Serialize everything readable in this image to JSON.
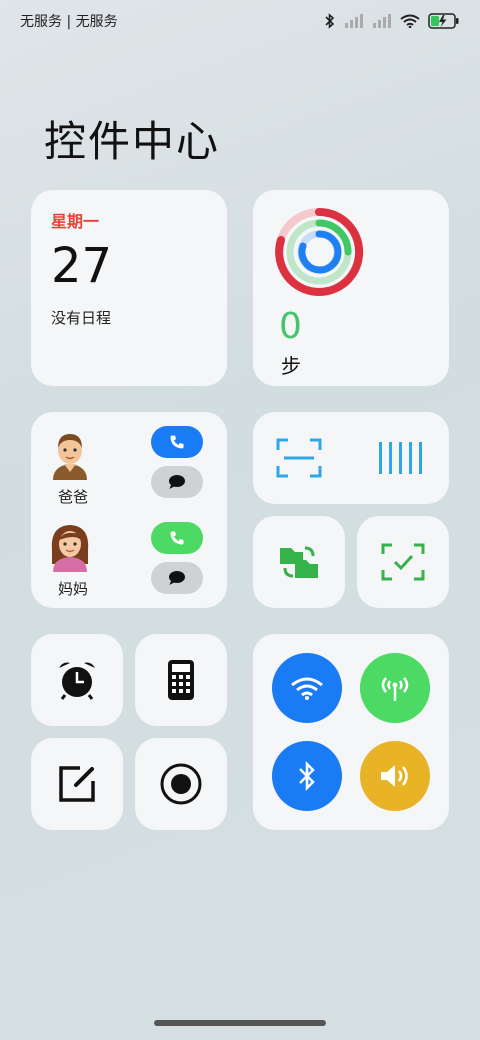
{
  "status_bar": {
    "carrier": "无服务 | 无服务"
  },
  "page": {
    "title": "控件中心"
  },
  "calendar": {
    "weekday": "星期一",
    "day": "27",
    "note": "没有日程"
  },
  "steps": {
    "value": "0",
    "unit": "步"
  },
  "contacts": [
    {
      "name": "爸爸"
    },
    {
      "name": "妈妈"
    }
  ],
  "colors": {
    "accent_blue": "#1a7cf5",
    "accent_green": "#4cd964",
    "accent_yellow": "#e9b326",
    "weekday_red": "#e8433b",
    "steps_green": "#46c46a",
    "scan_blue": "#2fa6e6"
  },
  "icons": {
    "alarm": "alarm-clock-icon",
    "calculator": "calculator-icon",
    "note": "edit-note-icon",
    "record": "screen-record-icon",
    "wifi": "wifi-icon",
    "hotspot": "hotspot-icon",
    "bluetooth": "bluetooth-icon",
    "volume": "volume-icon"
  }
}
